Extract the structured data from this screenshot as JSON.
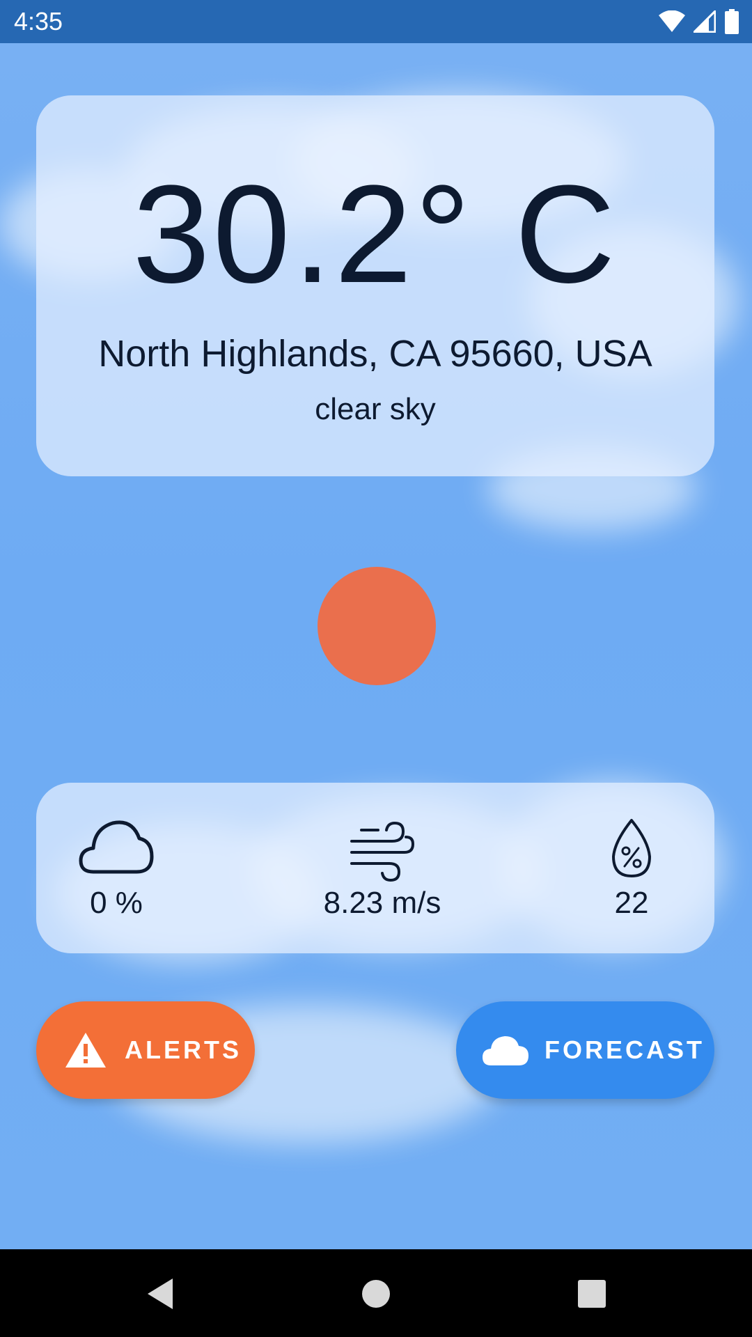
{
  "status_bar": {
    "time": "4:35",
    "icons": [
      "wifi-icon",
      "signal-icon",
      "battery-icon"
    ]
  },
  "weather": {
    "temperature": "30.2° C",
    "location": "North Highlands, CA 95660, USA",
    "description": "clear sky",
    "condition_icon": "sun-icon"
  },
  "stats": [
    {
      "icon": "cloud-icon",
      "value": "0 %"
    },
    {
      "icon": "wind-icon",
      "value": "8.23 m/s"
    },
    {
      "icon": "humidity-icon",
      "value": "22"
    }
  ],
  "buttons": {
    "alerts_label": "ALERTS",
    "alerts_icon": "warning-icon",
    "forecast_label": "FORECAST",
    "forecast_icon": "cloud-icon"
  },
  "nav_bar": {
    "icons": [
      "back-icon",
      "home-icon",
      "recents-icon"
    ]
  },
  "colors": {
    "status_bar": "#2668b3",
    "sky": "#71adf3",
    "sun": "#ea6f4d",
    "alerts_button": "#f36f37",
    "forecast_button": "#348bee",
    "text": "#0d1a30"
  }
}
